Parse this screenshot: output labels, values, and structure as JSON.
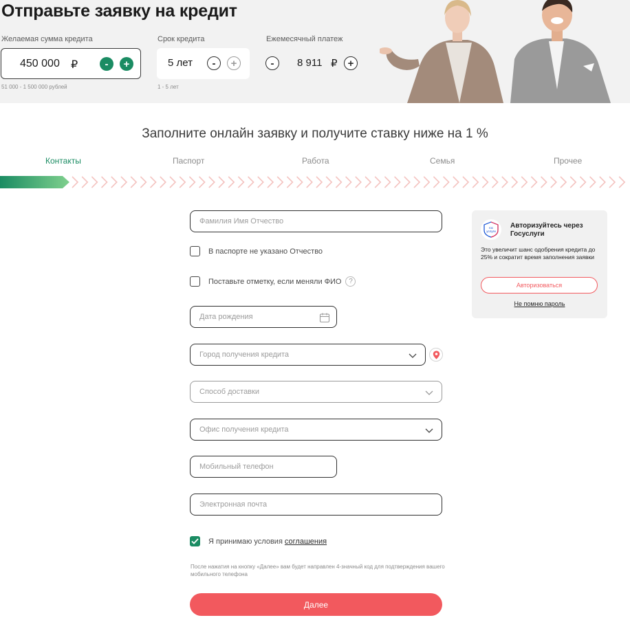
{
  "header": {
    "title": "Отправьте заявку на кредит",
    "amount": {
      "label": "Желаемая сумма кредита",
      "value": "450 000",
      "currency": "₽",
      "hint": "51 000 - 1 500 000 рублей",
      "minus": "-",
      "plus": "+"
    },
    "term": {
      "label": "Срок кредита",
      "value": "5 лет",
      "hint": "1 - 5 лет",
      "minus": "-",
      "plus": "+"
    },
    "payment": {
      "label": "Ежемесячный платеж",
      "value": "8 911",
      "currency": "₽",
      "minus": "-",
      "plus": "+"
    }
  },
  "form": {
    "heading": "Заполните онлайн заявку и получите ставку ниже на 1 %",
    "steps": [
      "Контакты",
      "Паспорт",
      "Работа",
      "Семья",
      "Прочее"
    ],
    "active_step": 0,
    "progress_fraction": 0.11,
    "fields": {
      "fio": "Фамилия Имя Отчество",
      "no_patronymic": "В паспорте не указано Отчество",
      "changed_fio": "Поставьте отметку, если меняли ФИО",
      "help_glyph": "?",
      "birth_date": "Дата рождения",
      "city": "Город получения кредита",
      "delivery": "Способ доставки",
      "office": "Офис получения кредита",
      "phone": "Мобильный телефон",
      "email": "Электронная почта"
    },
    "agreement": {
      "text": "Я принимаю условия",
      "link": "соглашения",
      "checked": true
    },
    "notice": "После нажатия на кнопку «Далее» вам будет направлен 4-значный код для подтверждения вашего мобильного телефона",
    "submit": "Далее"
  },
  "gosuslugi": {
    "logo_text_1": "гос",
    "logo_text_2": "услуги",
    "title": "Авторизуйтесь через Госуслуги",
    "description": "Это увеличит шанс одобрения кредита до 25% и сократит время заполнения заявки",
    "button": "Авторизоваться",
    "forgot": "Не помню пароль"
  },
  "colors": {
    "accent": "#1b8c63",
    "primary_button": "#f2595e",
    "header_bg": "#f2f2f2"
  }
}
